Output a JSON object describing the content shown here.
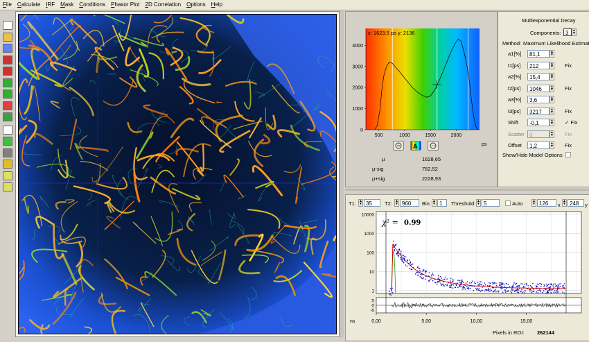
{
  "menu": [
    "File",
    "Calculate",
    "IRF",
    "Mask",
    "Conditions",
    "Phasor Plot",
    "2D Correlation",
    "Options",
    "Help"
  ],
  "toolbar_icons": [
    "new-document-icon",
    "open-folder-icon",
    "save-disk-icon",
    "lock-red-icon",
    "lock-open-icon",
    "arrow-green-icon",
    "arrow-green-2-icon",
    "stack-red-icon",
    "stack-multi-icon",
    "grid-view-icon",
    "grid-columns-icon",
    "binoculars-icon",
    "color-palette-icon",
    "zoom-in-icon",
    "zoom-out-icon"
  ],
  "histogram": {
    "cursor_label": "x: 1623.5  ps   y: 2136",
    "x_unit": "ps",
    "y_ticks": [
      "4000",
      "3000",
      "2000",
      "1000",
      "0"
    ],
    "x_ticks": [
      "500",
      "1000",
      "1500",
      "2000"
    ],
    "stats": [
      {
        "label": "µ",
        "value": "1628,65"
      },
      {
        "label": "µ-sig",
        "value": "762,52"
      },
      {
        "label": "µ+sig",
        "value": "2228,93"
      }
    ]
  },
  "model": {
    "title": "Multiexponential Decay",
    "components_label": "Components:",
    "components_value": "3",
    "method_label": "Method:",
    "method_value": "Maximum Likelihood Estimation",
    "params": [
      {
        "label": "a1[%]",
        "value": "81,1",
        "fix": false,
        "fix_label": ""
      },
      {
        "label": "t1[ps]",
        "value": "212",
        "fix": false,
        "fix_label": "Fix"
      },
      {
        "label": "a2[%]",
        "value": "15,4",
        "fix": false,
        "fix_label": ""
      },
      {
        "label": "t2[ps]",
        "value": "1046",
        "fix": false,
        "fix_label": "Fix"
      },
      {
        "label": "a3[%]",
        "value": "3,6",
        "fix": false,
        "fix_label": ""
      },
      {
        "label": "t3[ps]",
        "value": "3217",
        "fix": false,
        "fix_label": "Fix"
      },
      {
        "label": "Shift",
        "value": "-0,1",
        "fix": true,
        "fix_label": "✓ Fix"
      },
      {
        "label": "Scatter",
        "value": "0",
        "fix": true,
        "fix_label": "Fix"
      },
      {
        "label": "Offset",
        "value": "1,2",
        "fix": false,
        "fix_label": "Fix"
      }
    ],
    "show_hide_label": "Show/Hide Model Options"
  },
  "decay": {
    "t1_label": "T1:",
    "t1_value": "35",
    "t2_label": "T2:",
    "t2_value": "960",
    "bin_label": "Bin:",
    "bin_value": "1",
    "threshold_label": "Threshold:",
    "threshold_value": "5",
    "auto_label": "Auto",
    "x_value": "126",
    "x_sep": "x",
    "y_value": "248",
    "y_sep": "y",
    "chi_label": "χ² =",
    "chi_value": "0.99",
    "y_ticks": [
      "10000",
      "1000",
      "100",
      "10",
      "1"
    ],
    "res_ticks": [
      "5",
      "0",
      "-5"
    ],
    "x_ticks": [
      "0,00",
      "5,00",
      "10,00",
      "15,00"
    ],
    "x_unit": "ns",
    "pixels_label": "Pixels in ROI:",
    "pixels_value": "262144"
  },
  "colors": {
    "accent": "#0000ff",
    "fit": "#d40000",
    "irf": "#00b000",
    "data": "#1010c0"
  }
}
